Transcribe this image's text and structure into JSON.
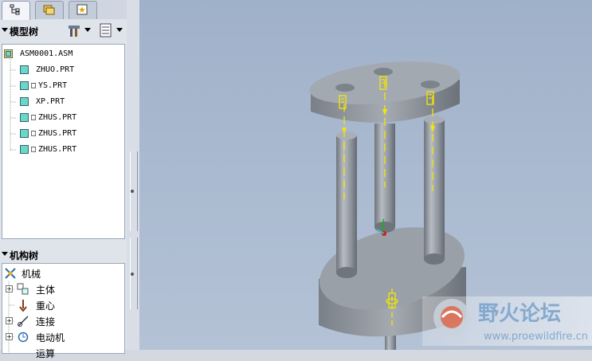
{
  "tabs": [
    {
      "name": "model-tree-tab",
      "icon": "tree-icon",
      "active": true
    },
    {
      "name": "folder-browser-tab",
      "icon": "folder-icon",
      "active": false
    },
    {
      "name": "favorites-tab",
      "icon": "star-icon",
      "active": false
    }
  ],
  "model_tree": {
    "title": "模型树",
    "toolbar_icons": [
      "settings-tools-icon",
      "tree-filter-icon"
    ],
    "root": "ASM0001.ASM",
    "items": [
      "ZHUO.PRT",
      "YS.PRT",
      "XP.PRT",
      "ZHUS.PRT",
      "ZHUS.PRT",
      "ZHUS.PRT"
    ]
  },
  "mech_tree": {
    "title": "机构树",
    "root": "机械",
    "items": [
      "主体",
      "重心",
      "连接",
      "电动机",
      "运算"
    ]
  },
  "watermark": {
    "title": "野火论坛",
    "url": "www.proewildfire.cn"
  },
  "colors": {
    "viewport_top": "#9fb1c9",
    "model_gray": "#8e949c",
    "axis_yellow": "#f5e600"
  }
}
